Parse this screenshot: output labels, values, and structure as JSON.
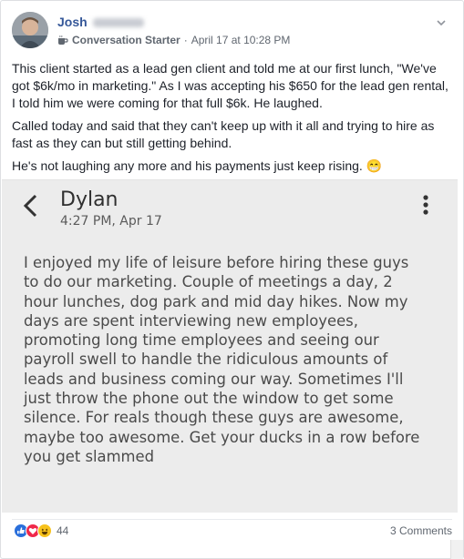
{
  "post": {
    "author_name": "Josh",
    "badge_icon": "coffee-cup-icon",
    "badge_label": "Conversation Starter",
    "separator": "·",
    "timestamp": "April 17 at 10:28 PM",
    "paragraphs": [
      "This client started as a lead gen client and told me at our first lunch, \"We've got $6k/mo in marketing.\" As I was accepting his $650 for the lead gen rental, I told him we were coming for that full $6k. He laughed.",
      "Called today and said that they can't keep up with it all and trying to hire as fast as they can but still getting behind.",
      "He's not laughing any more and his payments just keep rising. 😁"
    ]
  },
  "screenshot": {
    "contact_name": "Dylan",
    "timestamp": "4:27 PM, Apr 17",
    "message": "I enjoyed my life of leisure before hiring these guys to do our marketing. Couple of meetings a day, 2 hour lunches, dog park and mid day hikes. Now my days are spent interviewing new employees, promoting long time employees and seeing our payroll swell to handle the ridiculous amounts of leads and business coming our way.  Sometimes I'll just throw the phone out the window to get some silence.  For reals though these guys are awesome, maybe too awesome.  Get your ducks in a row before you get slammed"
  },
  "footer": {
    "reaction_icons": [
      "like-icon",
      "love-icon",
      "haha-icon"
    ],
    "reaction_count": "44",
    "comments_label": "3 Comments"
  },
  "colors": {
    "author_link": "#365899",
    "like": "#2a6fdb",
    "love": "#f0284a",
    "haha": "#f7c21c"
  }
}
